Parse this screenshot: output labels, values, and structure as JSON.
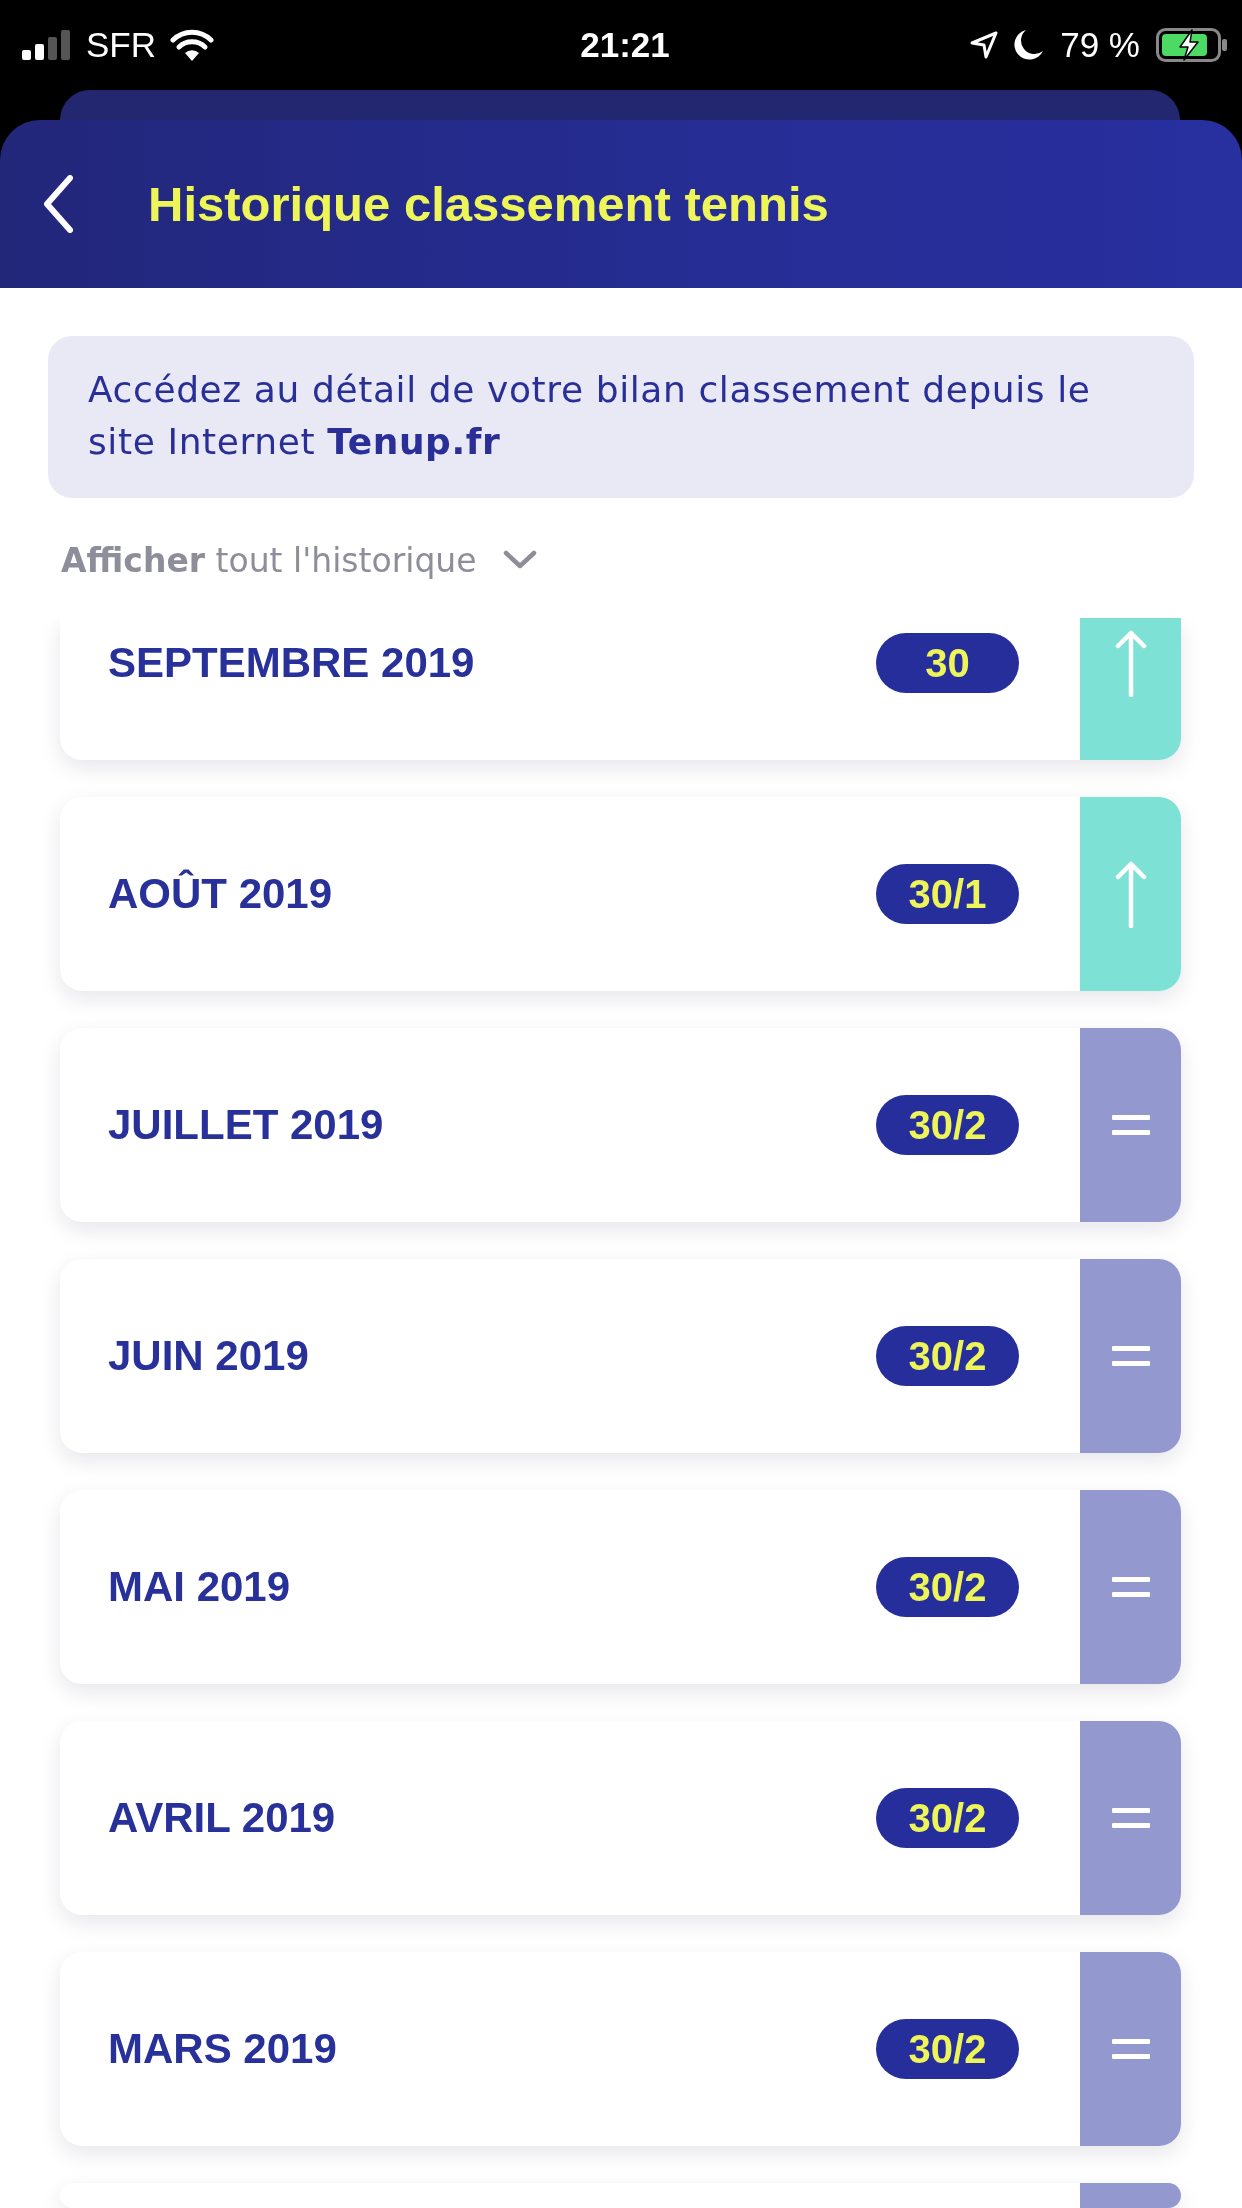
{
  "status_bar": {
    "carrier": "SFR",
    "time": "21:21",
    "battery": "79 %"
  },
  "header": {
    "title": "Historique classement tennis"
  },
  "info": {
    "text": "Accédez au détail de votre bilan classement depuis le site Internet **Tenup.fr**"
  },
  "filter": {
    "label": "**Afficher** tout l'historique",
    "expanded": false
  },
  "history": [
    {
      "month": "SEPTEMBRE 2019",
      "rank": "30",
      "kind": "up"
    },
    {
      "month": "AOÛT 2019",
      "rank": "30/1",
      "kind": "up"
    },
    {
      "month": "JUILLET 2019",
      "rank": "30/2",
      "kind": "same"
    },
    {
      "month": "JUIN 2019",
      "rank": "30/2",
      "kind": "same"
    },
    {
      "month": "MAI 2019",
      "rank": "30/2",
      "kind": "same"
    },
    {
      "month": "AVRIL 2019",
      "rank": "30/2",
      "kind": "same"
    },
    {
      "month": "MARS 2019",
      "rank": "30/2",
      "kind": "same"
    },
    {
      "kind": "same"
    }
  ]
}
